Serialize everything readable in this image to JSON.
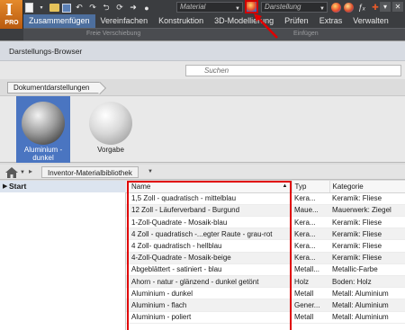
{
  "app": {
    "logo_letter": "I",
    "logo_tag": "PRO",
    "material_select": "Material",
    "appearance_select": "Darstellung",
    "ribbon_tabs": [
      "Zusammenfügen",
      "Vereinfachen",
      "Konstruktion",
      "3D-Modellierung",
      "Prüfen",
      "Extras",
      "Verwalten"
    ],
    "active_tab": "Zusammenfügen",
    "ribbon_ghost": [
      "Freie Verschiebung",
      "Einfügen"
    ],
    "highlight_color": "#e00000"
  },
  "browser": {
    "title": "Darstellungs-Browser",
    "search_placeholder": "Suchen",
    "doc_breadcrumb": "Dokumentdarstellungen",
    "thumbnails": [
      {
        "label": "Aluminium - dunkel",
        "selected": true
      },
      {
        "label": "Vorgabe",
        "selected": false
      }
    ],
    "library_breadcrumb": "Inventor-Materialbibliothek",
    "tree_root": "Start",
    "columns": {
      "name": "Name",
      "typ": "Typ",
      "kategorie": "Kategorie"
    },
    "rows": [
      {
        "name": "1,5 Zoll - quadratisch - mittelblau",
        "typ": "Kera...",
        "kategorie": "Keramik: Fliese"
      },
      {
        "name": "12 Zoll - Läuferverband - Burgund",
        "typ": "Maue...",
        "kategorie": "Mauerwerk: Ziegel"
      },
      {
        "name": "1-Zoll-Quadrate - Mosaik-blau",
        "typ": "Kera...",
        "kategorie": "Keramik: Fliese"
      },
      {
        "name": "4 Zoll - quadratisch -...egter Raute - grau-rot",
        "typ": "Kera...",
        "kategorie": "Keramik: Fliese"
      },
      {
        "name": "4 Zoll- quadratisch - hellblau",
        "typ": "Kera...",
        "kategorie": "Keramik: Fliese"
      },
      {
        "name": "4-Zoll-Quadrate - Mosaik-beige",
        "typ": "Kera...",
        "kategorie": "Keramik: Fliese"
      },
      {
        "name": "Abgeblättert - satiniert - blau",
        "typ": "Metall...",
        "kategorie": "Metallic-Farbe"
      },
      {
        "name": "Ahorn - natur - glänzend - dunkel getönt",
        "typ": "Holz",
        "kategorie": "Boden: Holz"
      },
      {
        "name": "Aluminium - dunkel",
        "typ": "Metall",
        "kategorie": "Metall: Aluminium"
      },
      {
        "name": "Aluminium - flach",
        "typ": "Gener...",
        "kategorie": "Metall: Aluminium"
      },
      {
        "name": "Aluminium - poliert",
        "typ": "Metall",
        "kategorie": "Metall: Aluminium"
      }
    ]
  }
}
